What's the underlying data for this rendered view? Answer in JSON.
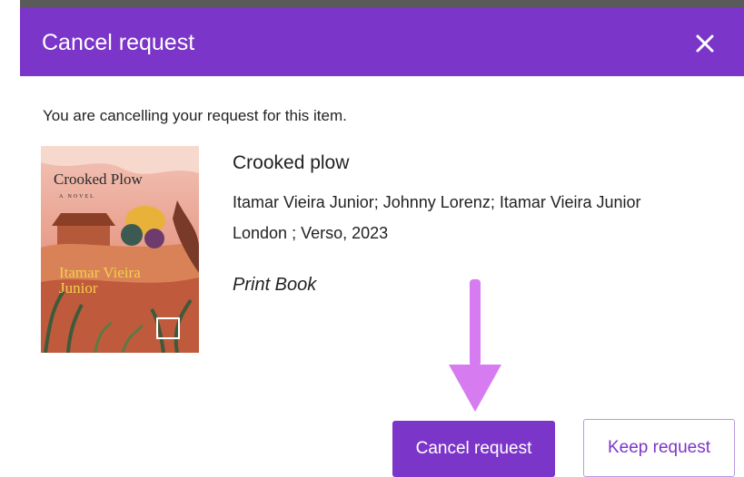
{
  "dialog": {
    "title": "Cancel request",
    "close_icon": "close-icon",
    "intro": "You are cancelling your request for this item."
  },
  "item": {
    "cover": {
      "title": "Crooked Plow",
      "subtitle": "A NOVEL",
      "author_line1": "Itamar Vieira",
      "author_line2": "Junior"
    },
    "title": "Crooked plow",
    "authors": "Itamar Vieira Junior; Johnny Lorenz; Itamar Vieira Junior",
    "publisher": "London ; Verso, 2023",
    "format": "Print Book"
  },
  "actions": {
    "cancel_label": "Cancel request",
    "keep_label": "Keep request"
  },
  "colors": {
    "accent": "#7c35c9",
    "annotation_arrow": "#d67cf0"
  }
}
